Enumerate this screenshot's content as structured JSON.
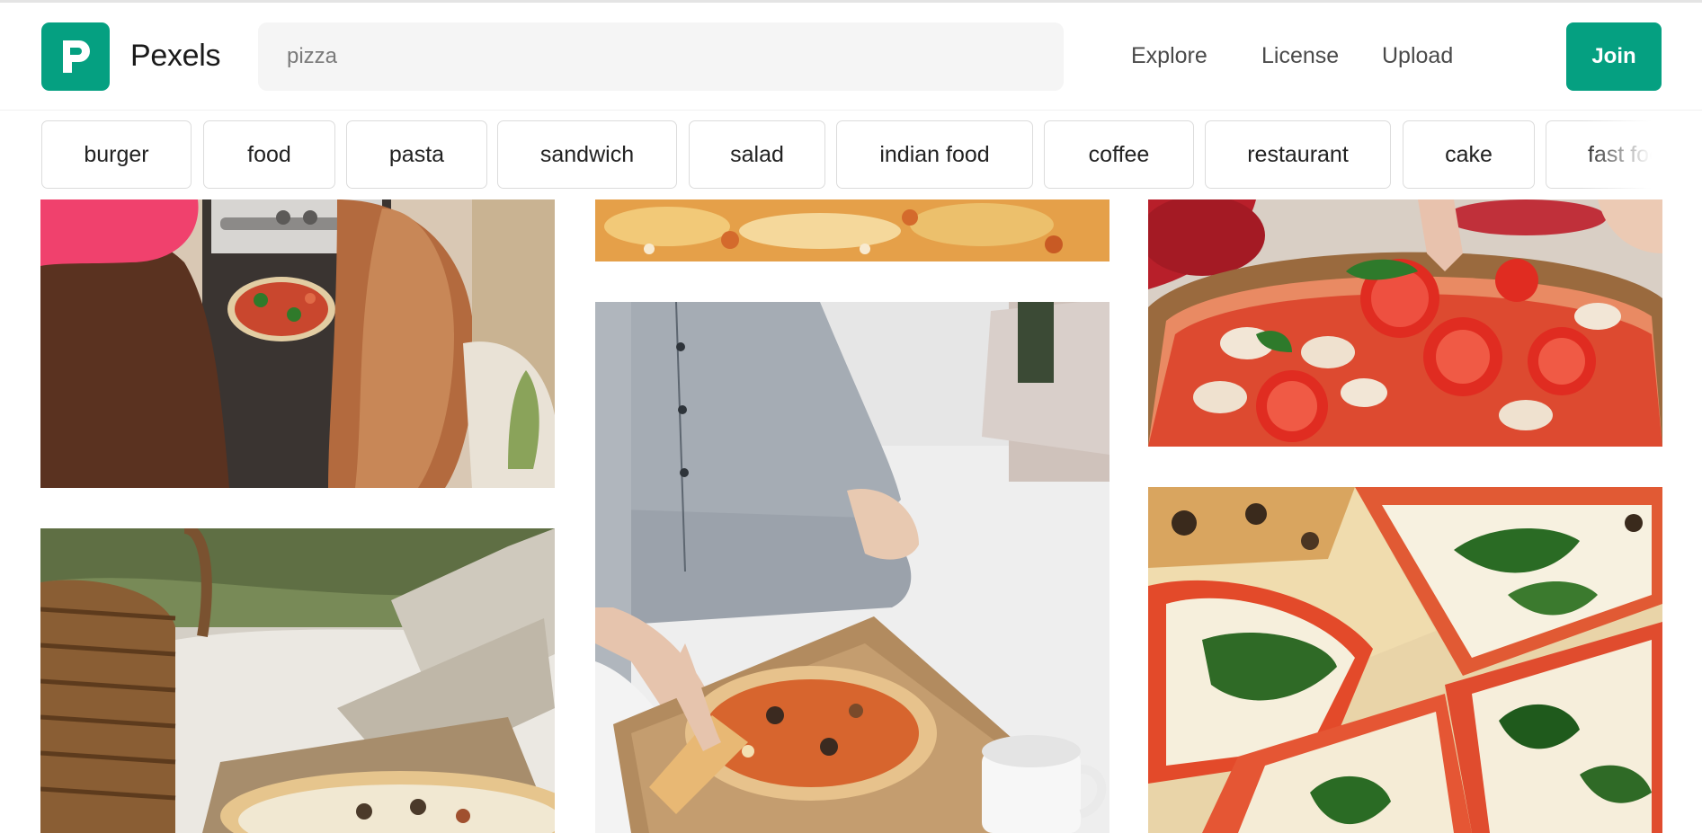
{
  "brand": {
    "name": "Pexels",
    "color": "#05a081"
  },
  "search": {
    "value": "",
    "placeholder": "pizza"
  },
  "nav": {
    "explore": "Explore",
    "license": "License",
    "upload": "Upload",
    "join": "Join"
  },
  "chips": [
    "burger",
    "food",
    "pasta",
    "sandwich",
    "salad",
    "indian food",
    "coffee",
    "restaurant",
    "cake",
    "fast food"
  ],
  "photos": [
    {
      "subject": "two girls putting a pizza into an oven"
    },
    {
      "subject": "pizza on a picnic blanket beside a wicker basket"
    },
    {
      "subject": "close-up of pizza cheese and toppings"
    },
    {
      "subject": "person in grey pyjamas eating pizza on a bed"
    },
    {
      "subject": "hands topping a pizza with mushrooms and tomatoes"
    },
    {
      "subject": "margherita pizza slices with basil"
    }
  ]
}
